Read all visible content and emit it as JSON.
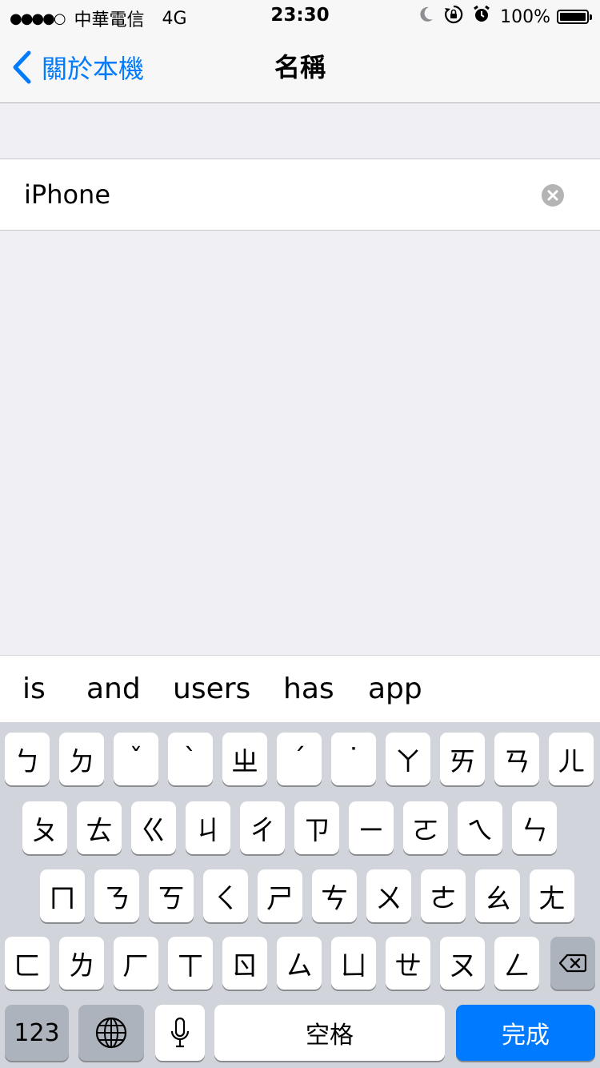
{
  "status_bar": {
    "signal": "●●●●○",
    "carrier": "中華電信",
    "network": "4G",
    "time": "23:30",
    "icons": [
      "moon-icon",
      "rotation-lock-icon",
      "alarm-icon"
    ],
    "battery_percent": "100%"
  },
  "nav": {
    "back_label": "關於本機",
    "title": "名稱"
  },
  "field": {
    "value": "iPhone"
  },
  "suggestions": [
    "is",
    "and",
    "users",
    "has",
    "app"
  ],
  "keyboard": {
    "rows": [
      [
        "ㄅ",
        "ㄉ",
        "ˇ",
        "ˋ",
        "ㄓ",
        "ˊ",
        "˙",
        "ㄚ",
        "ㄞ",
        "ㄢ",
        "ㄦ"
      ],
      [
        "ㄆ",
        "ㄊ",
        "ㄍ",
        "ㄐ",
        "ㄔ",
        "ㄗ",
        "ㄧ",
        "ㄛ",
        "ㄟ",
        "ㄣ"
      ],
      [
        "ㄇ",
        "ㄋ",
        "ㄎ",
        "ㄑ",
        "ㄕ",
        "ㄘ",
        "ㄨ",
        "ㄜ",
        "ㄠ",
        "ㄤ"
      ],
      [
        "ㄈ",
        "ㄌ",
        "ㄏ",
        "ㄒ",
        "ㄖ",
        "ㄙ",
        "ㄩ",
        "ㄝ",
        "ㄡ",
        "ㄥ"
      ]
    ],
    "numbers_label": "123",
    "space_label": "空格",
    "done_label": "完成"
  },
  "colors": {
    "accent": "#007aff",
    "background": "#efeff4",
    "keyboard_bg": "#d1d5db",
    "dark_key": "#acb3bc"
  }
}
